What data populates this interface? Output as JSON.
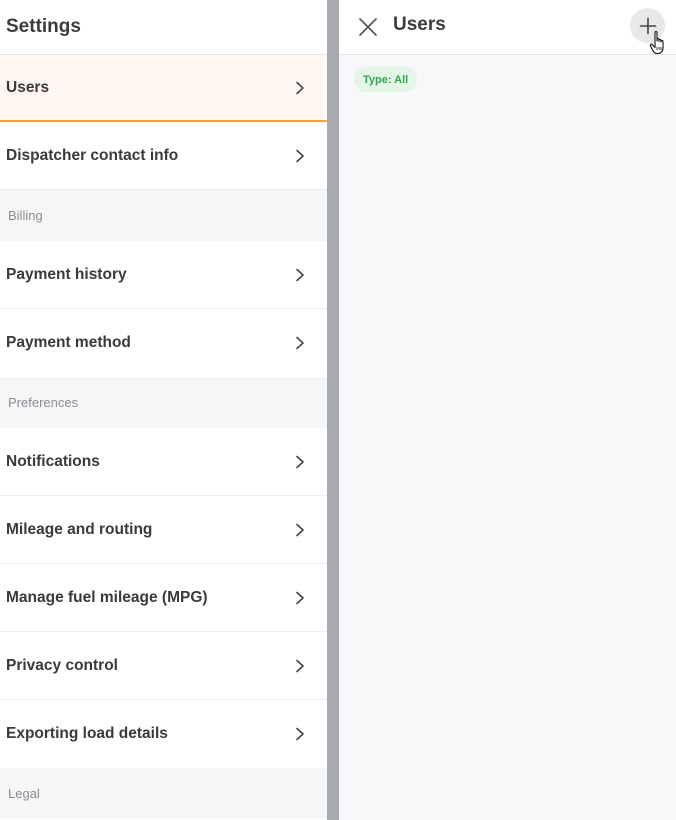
{
  "left": {
    "title": "Settings",
    "sections": [
      {
        "type": "item",
        "label": "Users",
        "active": true
      },
      {
        "type": "item",
        "label": "Dispatcher contact info"
      },
      {
        "type": "header",
        "label": "Billing"
      },
      {
        "type": "item",
        "label": "Payment history"
      },
      {
        "type": "item",
        "label": "Payment method"
      },
      {
        "type": "header",
        "label": "Preferences"
      },
      {
        "type": "item",
        "label": "Notifications"
      },
      {
        "type": "item",
        "label": "Mileage and routing"
      },
      {
        "type": "item",
        "label": "Manage fuel mileage (MPG)"
      },
      {
        "type": "item",
        "label": "Privacy control"
      },
      {
        "type": "item",
        "label": "Exporting load details"
      },
      {
        "type": "header",
        "label": "Legal"
      }
    ]
  },
  "right": {
    "title": "Users",
    "filter_chip": "Type: All",
    "icons": {
      "close": "close-icon",
      "add": "plus-icon",
      "cursor": "hand-cursor-icon"
    }
  },
  "colors": {
    "accent": "#f0a03c",
    "active_bg": "#fff6f1",
    "chip_bg": "#e3f5e7",
    "chip_text": "#33a852",
    "divider": "#a7abb0"
  }
}
